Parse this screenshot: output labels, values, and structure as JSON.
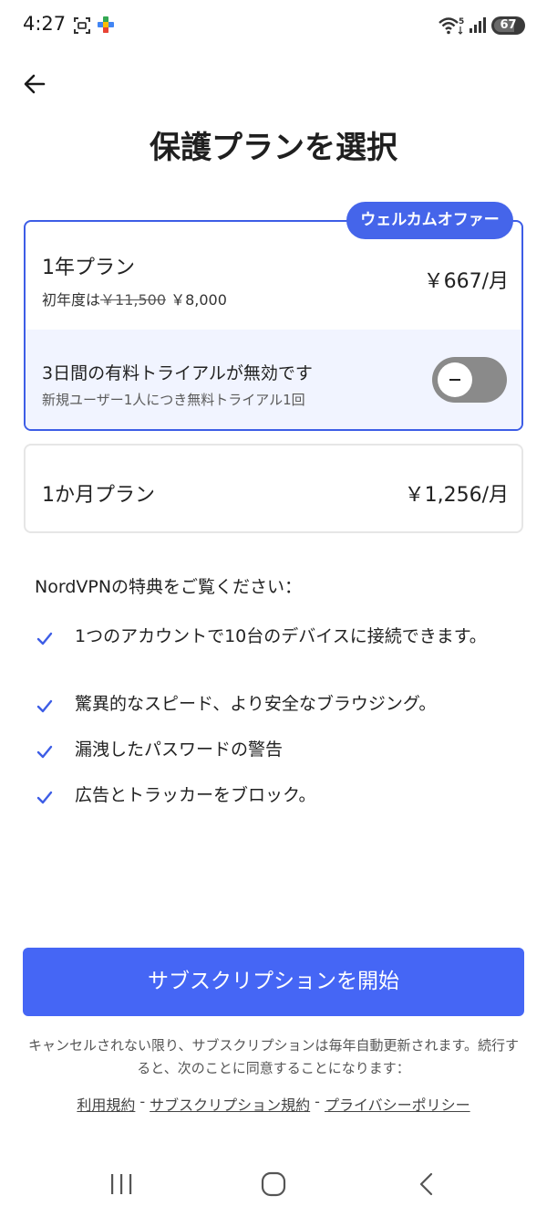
{
  "status_bar": {
    "time": "4:27",
    "battery": "67",
    "icons": [
      "screenshot-icon",
      "play-games-icon",
      "wifi-icon",
      "signal-icon",
      "battery-icon"
    ]
  },
  "header": {
    "back_icon": "arrow-left-icon",
    "title": "保護プランを選択"
  },
  "plans": {
    "annual": {
      "badge": "ウェルカムオファー",
      "name": "1年プラン",
      "first_year_prefix": "初年度は",
      "original_price": "￥11,500",
      "discount_price": "￥8,000",
      "price": "￥667/月",
      "trial_title": "3日間の有料トライアルが無効です",
      "trial_sub": "新規ユーザー1人につき無料トライアル1回",
      "trial_enabled": false
    },
    "monthly": {
      "name": "1か月プラン",
      "price": "￥1,256/月"
    }
  },
  "benefits": {
    "heading": "NordVPNの特典をご覧ください：",
    "items": [
      "1つのアカウントで10台のデバイスに接続できます。",
      "驚異的なスピード、より安全なブラウジング。",
      "漏洩したパスワードの警告",
      "広告とトラッカーをブロック。"
    ]
  },
  "cta": {
    "start_label": "サブスクリプションを開始"
  },
  "legal": {
    "text": "キャンセルされない限り、サブスクリプションは毎年自動更新されます。続行すると、次のことに同意することになります：",
    "links": [
      "利用規約",
      "サブスクリプション規約",
      "プライバシーポリシー"
    ],
    "separator": "-"
  },
  "nav": {
    "icons": [
      "recent-apps-icon",
      "home-icon",
      "back-icon"
    ]
  },
  "colors": {
    "accent": "#4566F5",
    "selected_border": "#3D5DE6",
    "trial_bg": "#F1F4FF",
    "toggle_off": "#8A8A8A",
    "check": "#3D5DE6"
  }
}
